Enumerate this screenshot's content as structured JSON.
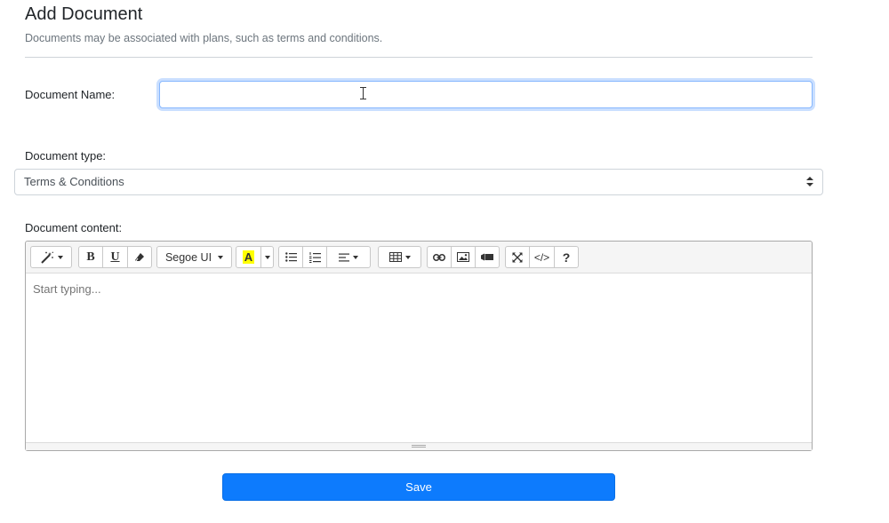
{
  "header": {
    "title": "Add Document",
    "subtitle": "Documents may be associated with plans, such as terms and conditions."
  },
  "form": {
    "name_label": "Document Name:",
    "name_value": "",
    "type_label": "Document type:",
    "type_selected": "Terms & Conditions",
    "content_label": "Document content:",
    "content_placeholder": "Start typing...",
    "save_label": "Save"
  },
  "toolbar": {
    "font_name": "Segoe UI",
    "groups": [
      {
        "name": "style",
        "icons": [
          "magic-wand-icon"
        ]
      },
      {
        "name": "font",
        "icons": [
          "bold-icon",
          "underline-icon",
          "eraser-icon"
        ]
      },
      {
        "name": "fontname",
        "icons": [
          "font-name-dropdown"
        ]
      },
      {
        "name": "color",
        "icons": [
          "highlight-color-icon"
        ]
      },
      {
        "name": "para",
        "icons": [
          "unordered-list-icon",
          "ordered-list-icon",
          "align-icon"
        ]
      },
      {
        "name": "table",
        "icons": [
          "table-icon"
        ]
      },
      {
        "name": "insert",
        "icons": [
          "link-icon",
          "image-icon",
          "video-icon"
        ]
      },
      {
        "name": "view",
        "icons": [
          "fullscreen-icon",
          "code-view-icon",
          "help-icon"
        ]
      }
    ],
    "bold_glyph": "B",
    "underline_glyph": "U",
    "color_glyph": "A",
    "code_glyph": "</>",
    "help_glyph": "?"
  },
  "colors": {
    "primary": "#0d7bfd",
    "highlight": "#ffff00",
    "focus_border": "#86b7fe"
  }
}
